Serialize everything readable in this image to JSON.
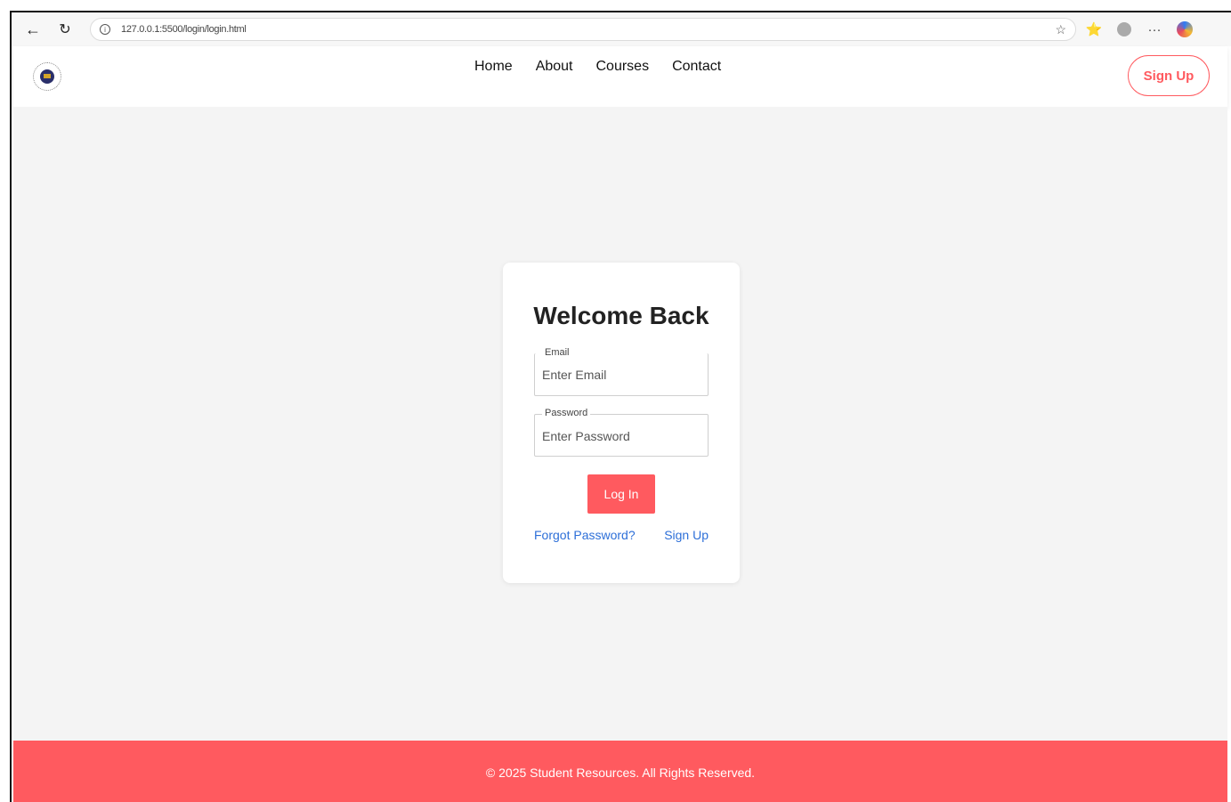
{
  "browser": {
    "url": "127.0.0.1:5500/login/login.html",
    "back_glyph": "←",
    "refresh_glyph": "↻",
    "info_glyph": "i",
    "star_glyph": "☆",
    "favorites_glyph": "⭐",
    "more_glyph": "···"
  },
  "header": {
    "nav": [
      "Home",
      "About",
      "Courses",
      "Contact"
    ],
    "signup_label": "Sign Up"
  },
  "login": {
    "title": "Welcome Back",
    "email_legend": "Email",
    "email_placeholder": "Enter Email",
    "password_legend": "Password",
    "password_placeholder": "Enter Password",
    "login_label": "Log In",
    "forgot_label": "Forgot Password?",
    "signup_link_label": "Sign Up"
  },
  "footer": {
    "text": "© 2025 Student Resources. All Rights Reserved."
  },
  "colors": {
    "accent": "#ff5a5f",
    "link": "#2d6fd8",
    "background": "#f4f4f4"
  }
}
